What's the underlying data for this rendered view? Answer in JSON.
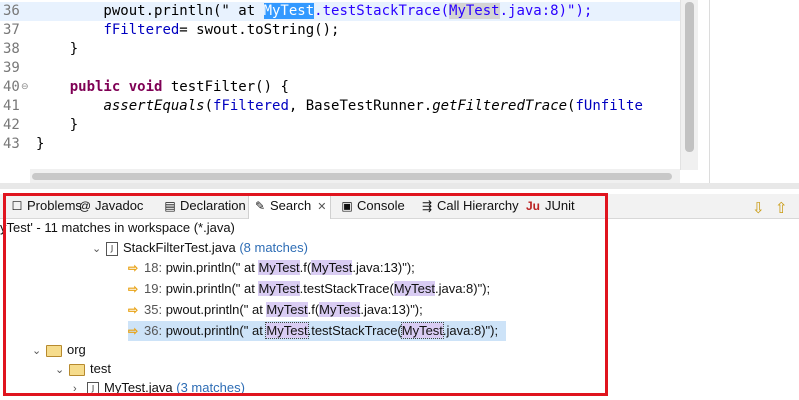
{
  "editor": {
    "lines": [
      {
        "num": "36",
        "code": [
          {
            "t": "        pwout.println(\" at ",
            "c": "str0"
          },
          {
            "t": "MyTest",
            "c": "sel"
          },
          {
            "t": ".testStackTrace(",
            "c": "str"
          },
          {
            "t": "MyTest",
            "c": "strocc"
          },
          {
            "t": ".java:8)\");",
            "c": "str"
          }
        ]
      },
      {
        "num": "37",
        "code": [
          {
            "t": "        ",
            "c": ""
          },
          {
            "t": "fFiltered",
            "c": "fld"
          },
          {
            "t": "= swout.toString();",
            "c": ""
          }
        ]
      },
      {
        "num": "38",
        "code": [
          {
            "t": "    }",
            "c": ""
          }
        ]
      },
      {
        "num": "39",
        "code": []
      },
      {
        "num": "40",
        "code": [
          {
            "t": "    ",
            "c": ""
          },
          {
            "t": "public void",
            "c": "kw"
          },
          {
            "t": " testFilter() {",
            "c": ""
          }
        ]
      },
      {
        "num": "41",
        "code": [
          {
            "t": "        ",
            "c": ""
          },
          {
            "t": "assertEquals",
            "c": "ital"
          },
          {
            "t": "(",
            "c": ""
          },
          {
            "t": "fFiltered",
            "c": "fld"
          },
          {
            "t": ", BaseTestRunner.",
            "c": ""
          },
          {
            "t": "getFilteredTrace",
            "c": "ital"
          },
          {
            "t": "(",
            "c": ""
          },
          {
            "t": "fUnfilte",
            "c": "fld"
          }
        ]
      },
      {
        "num": "42",
        "code": [
          {
            "t": "    }",
            "c": ""
          }
        ]
      },
      {
        "num": "43",
        "code": [
          {
            "t": "}",
            "c": ""
          }
        ]
      }
    ]
  },
  "tabs": [
    {
      "label": "Problems",
      "icon": "problems-icon",
      "glyph": "☐"
    },
    {
      "label": "Javadoc",
      "icon": "javadoc-icon",
      "glyph": "@"
    },
    {
      "label": "Declaration",
      "icon": "declaration-icon",
      "glyph": "▤"
    },
    {
      "label": "Search",
      "icon": "search-icon",
      "glyph": "✎",
      "active": true
    },
    {
      "label": "Console",
      "icon": "console-icon",
      "glyph": "▣"
    },
    {
      "label": "Call Hierarchy",
      "icon": "call-hierarchy-icon",
      "glyph": "⇶"
    },
    {
      "label": "JUnit",
      "icon": "junit-icon",
      "glyph": "Ju"
    }
  ],
  "status_text": "yTest' - 11 matches in workspace (*.java)",
  "tree": {
    "stackfilter_file": {
      "name": "StackFilterTest.java",
      "count": "(8 matches)"
    },
    "matches": [
      {
        "line": "18:",
        "pre": "pwin.println(\" at ",
        "m1": "MyTest",
        "mid": ".f(",
        "m2": "MyTest",
        "post": ".java:13)\");"
      },
      {
        "line": "19:",
        "pre": "pwin.println(\" at ",
        "m1": "MyTest",
        "mid": ".testStackTrace(",
        "m2": "MyTest",
        "post": ".java:8)\");"
      },
      {
        "line": "35:",
        "pre": "pwout.println(\" at ",
        "m1": "MyTest",
        "mid": ".f(",
        "m2": "MyTest",
        "post": ".java:13)\");"
      },
      {
        "line": "36:",
        "pre": "pwout.println(\" at ",
        "m1": "MyTest",
        "mid": ".testStackTrace(",
        "m2": "MyTest",
        "post": ".java:8)\");"
      }
    ],
    "org_label": "org",
    "test_label": "test",
    "mytest_file": {
      "name": "MyTest.java",
      "count": "(3 matches)"
    }
  },
  "colors": {
    "highlight_box": "#e0141e",
    "match_bg": "#d9ccf3",
    "selection": "#3399ff"
  }
}
